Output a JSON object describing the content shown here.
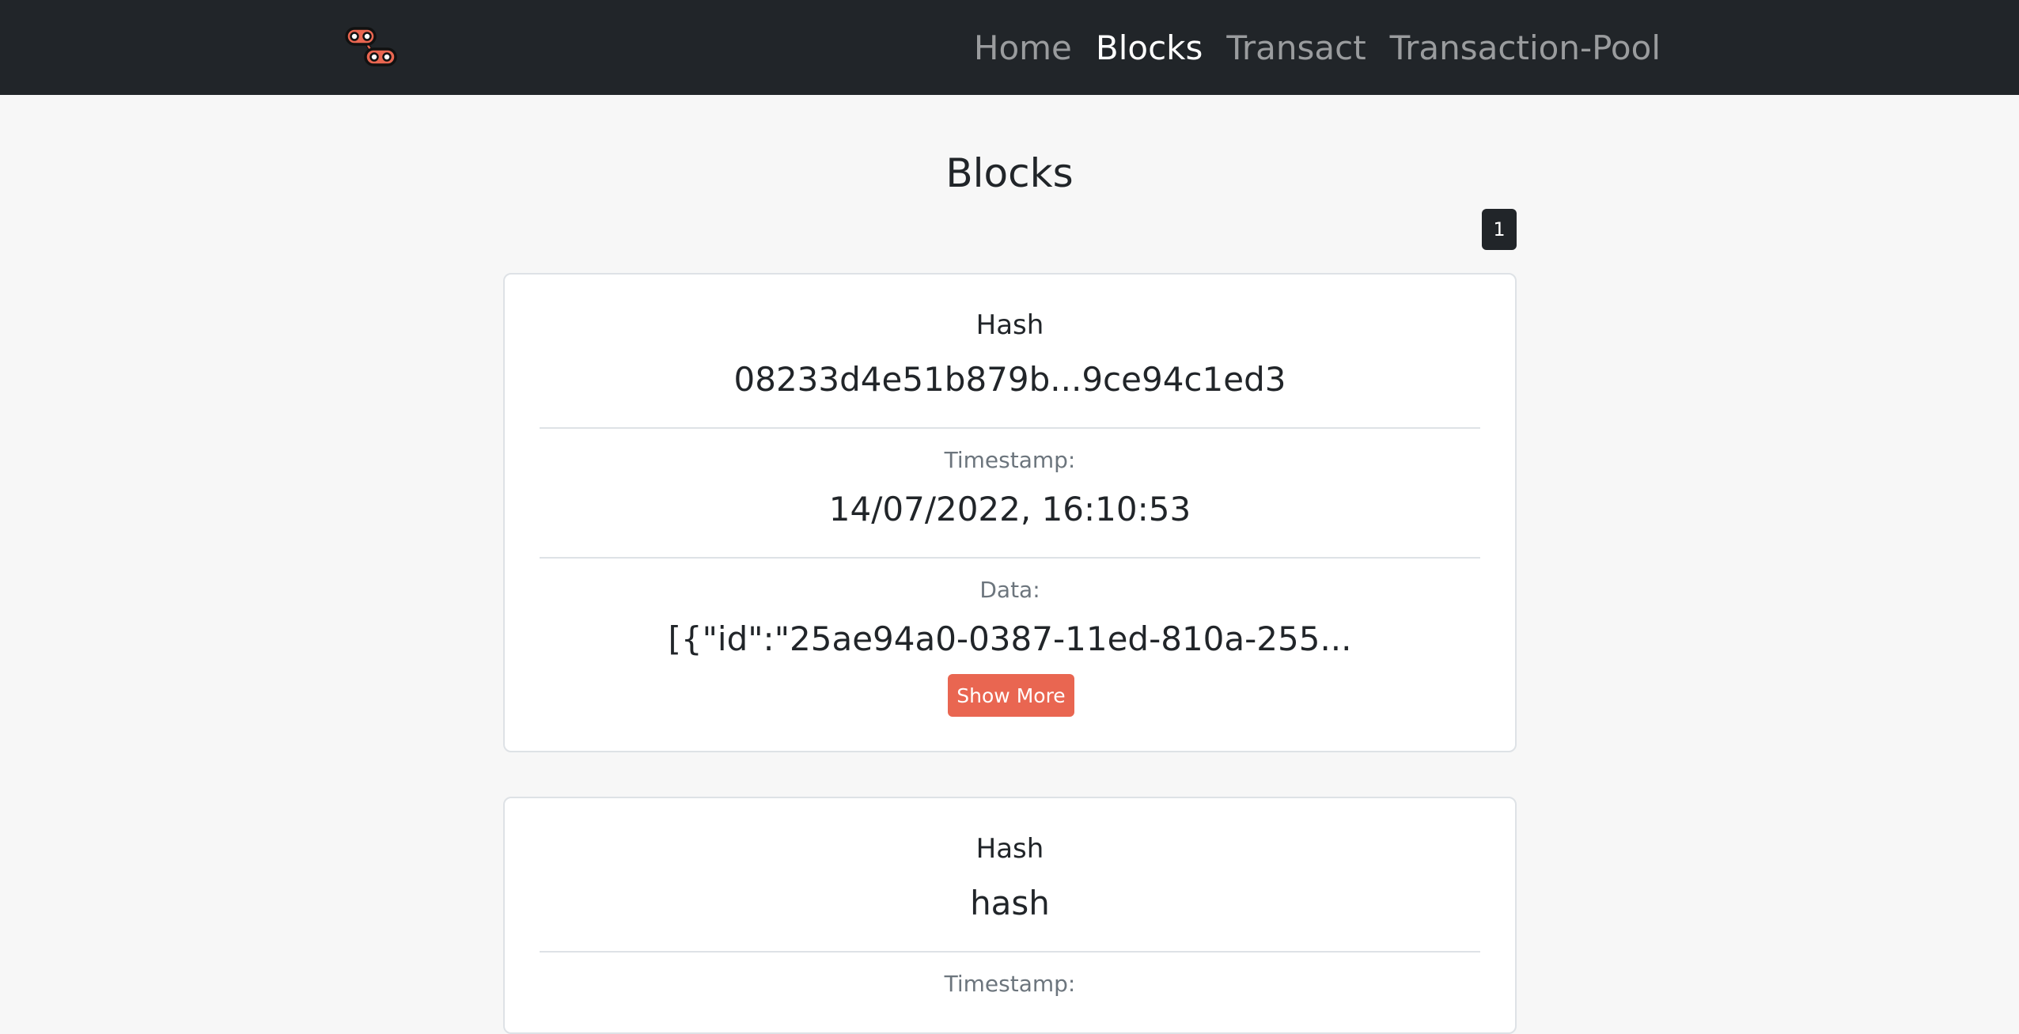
{
  "nav": {
    "links": [
      {
        "label": "Home",
        "active": false
      },
      {
        "label": "Blocks",
        "active": true
      },
      {
        "label": "Transact",
        "active": false
      },
      {
        "label": "Transaction-Pool",
        "active": false
      }
    ]
  },
  "page": {
    "title": "Blocks",
    "pagination": [
      "1"
    ]
  },
  "blocks": [
    {
      "hash_label": "Hash",
      "hash": "08233d4e51b879b...9ce94c1ed3",
      "timestamp_label": "Timestamp:",
      "timestamp": "14/07/2022, 16:10:53",
      "data_label": "Data:",
      "data": "[{\"id\":\"25ae94a0-0387-11ed-810a-255...",
      "button_label": "Show More"
    },
    {
      "hash_label": "Hash",
      "hash": "hash",
      "timestamp_label": "Timestamp:"
    }
  ],
  "colors": {
    "navbar_bg": "#212529",
    "accent": "#e96651",
    "page_bg": "#f7f7f7"
  },
  "icons": {
    "logo": "chain-links-icon"
  }
}
